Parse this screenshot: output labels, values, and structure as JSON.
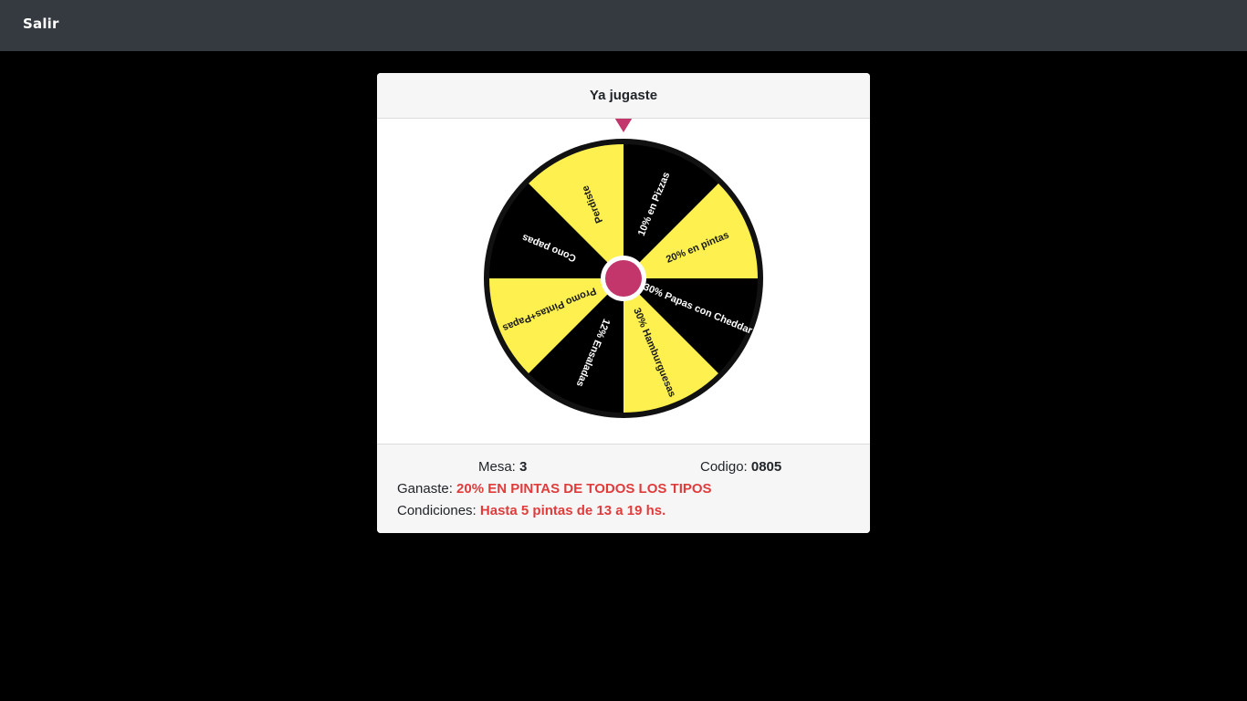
{
  "navbar": {
    "exit_label": "Salir"
  },
  "card": {
    "title": "Ya jugaste",
    "wheel": {
      "segments": [
        {
          "label": "10% en Pizzas",
          "color": "#000000",
          "text_color": "#ffffff"
        },
        {
          "label": "20% en pintas",
          "color": "#fdf04f",
          "text_color": "#1a1a1a"
        },
        {
          "label": "30% Papas con Cheddar",
          "color": "#000000",
          "text_color": "#ffffff"
        },
        {
          "label": "30% Hamburguesas",
          "color": "#fdf04f",
          "text_color": "#1a1a1a"
        },
        {
          "label": "12% Ensaladas",
          "color": "#000000",
          "text_color": "#ffffff"
        },
        {
          "label": "Promo Pintas+Papas",
          "color": "#fdf04f",
          "text_color": "#1a1a1a"
        },
        {
          "label": "Cono papas",
          "color": "#000000",
          "text_color": "#ffffff"
        },
        {
          "label": "Perdiste",
          "color": "#fdf04f",
          "text_color": "#1a1a1a"
        }
      ],
      "rim_color": "#111111",
      "hub_color": "#c2366b",
      "pointer_color": "#c2366b"
    },
    "footer": {
      "mesa_label": "Mesa:",
      "mesa_value": "3",
      "codigo_label": "Codigo:",
      "codigo_value": "0805",
      "ganaste_label": "Ganaste:",
      "ganaste_value": "20% EN PINTAS DE TODOS LOS TIPOS",
      "condiciones_label": "Condiciones:",
      "condiciones_value": "Hasta 5 pintas de 13 a 19 hs."
    }
  }
}
